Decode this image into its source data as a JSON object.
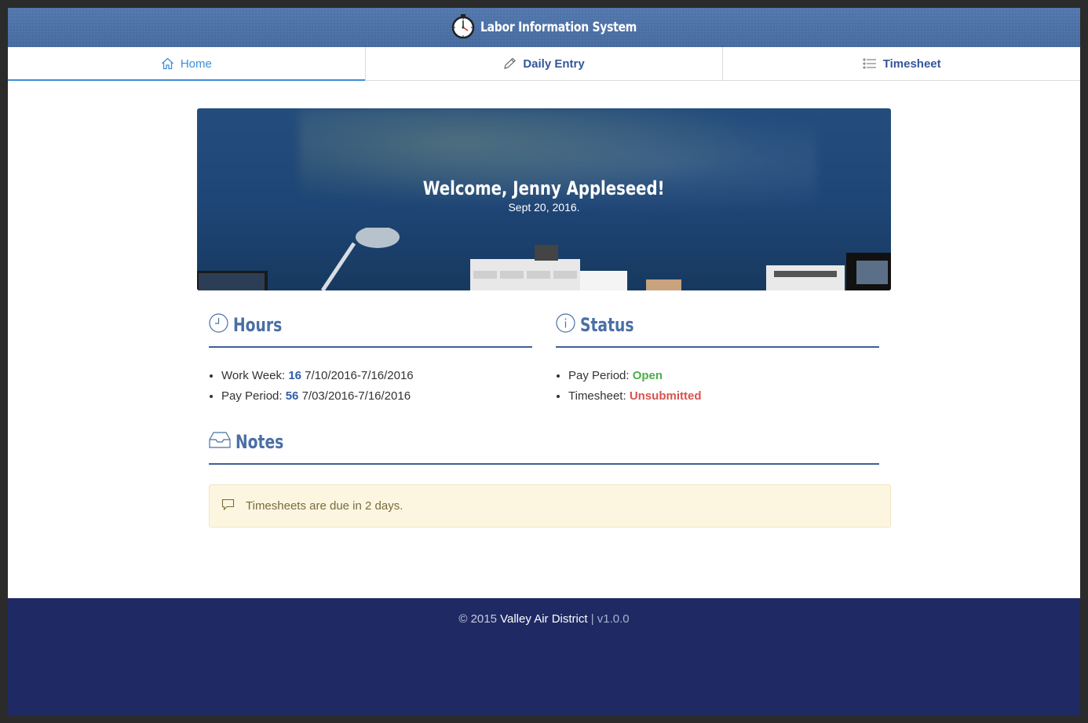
{
  "header": {
    "title": "Labor Information System",
    "logo_icon": "stopwatch-icon"
  },
  "tabs": [
    {
      "label": "Home",
      "icon": "home-icon",
      "active": true
    },
    {
      "label": "Daily Entry",
      "icon": "pencil-icon",
      "active": false
    },
    {
      "label": "Timesheet",
      "icon": "list-icon",
      "active": false
    }
  ],
  "hero": {
    "welcome": "Welcome, Jenny Appleseed!",
    "date": "Sept 20, 2016."
  },
  "hours": {
    "title": "Hours",
    "icon": "clock-icon",
    "work_week_label": "Work Week:",
    "work_week_hours": "16",
    "work_week_range": "7/10/2016-7/16/2016",
    "pay_period_label": "Pay Period:",
    "pay_period_hours": "56",
    "pay_period_range": "7/03/2016-7/16/2016"
  },
  "status": {
    "title": "Status",
    "icon": "info-icon",
    "pay_period_label": "Pay Period:",
    "pay_period_value": "Open",
    "timesheet_label": "Timesheet:",
    "timesheet_value": "Unsubmitted"
  },
  "notes": {
    "title": "Notes",
    "icon": "inbox-icon",
    "message_icon": "comment-icon",
    "message": "Timesheets are due in 2 days."
  },
  "footer": {
    "copyright": "© 2015",
    "org": "Valley Air District",
    "separator": "|",
    "version": "v1.0.0"
  },
  "colors": {
    "header_bg": "#4a6fa5",
    "active_tab": "#3b8fd9",
    "footer_bg": "#1f2a64",
    "open": "#4cae4c",
    "unsubmitted": "#d9534f"
  }
}
